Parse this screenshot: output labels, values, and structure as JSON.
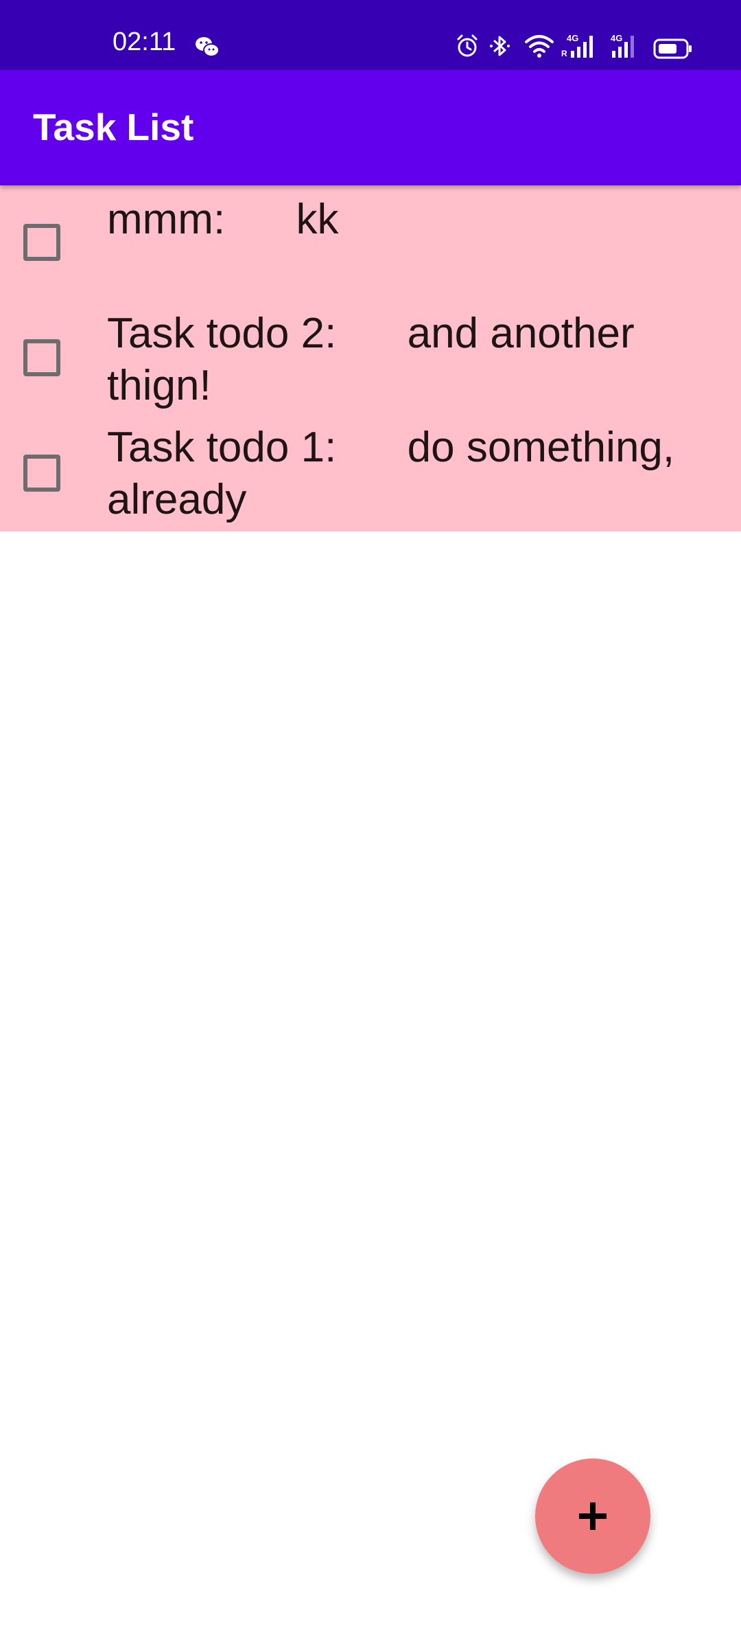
{
  "status_bar": {
    "time": "02:11",
    "icons": [
      "wechat-icon",
      "alarm-icon",
      "bluetooth-icon",
      "wifi-icon",
      "signal-4g-icon",
      "signal-4g-icon",
      "battery-icon"
    ],
    "background": "#3700b3"
  },
  "app_bar": {
    "title": "Task List",
    "background": "#6200ee"
  },
  "tasks": [
    {
      "text": "mmm:      kk",
      "checked": false
    },
    {
      "text": "Task todo 2:      and another thign!",
      "checked": false
    },
    {
      "text": "Task todo 1:      do something, already",
      "checked": false
    }
  ],
  "list_background": "#ffc0cb",
  "fab": {
    "icon": "plus-icon",
    "color": "#f07b7e"
  }
}
